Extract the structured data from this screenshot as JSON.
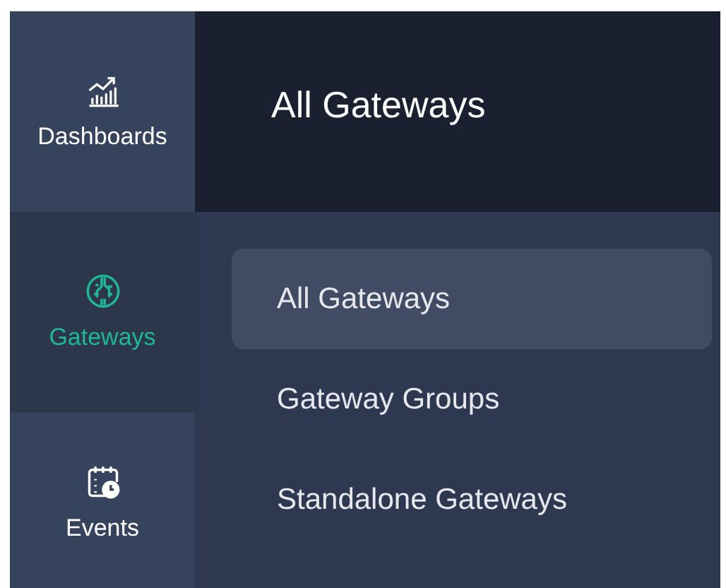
{
  "sidebar": {
    "items": [
      {
        "label": "Dashboards",
        "kind": "chart",
        "selected": false
      },
      {
        "label": "Gateways",
        "kind": "chip",
        "selected": true
      },
      {
        "label": "Events",
        "kind": "calendar",
        "selected": false
      }
    ]
  },
  "header": {
    "title": "All Gateways"
  },
  "submenu": {
    "items": [
      {
        "label": "All Gateways",
        "selected": true
      },
      {
        "label": "Gateway Groups",
        "selected": false
      },
      {
        "label": "Standalone Gateways",
        "selected": false
      }
    ]
  }
}
